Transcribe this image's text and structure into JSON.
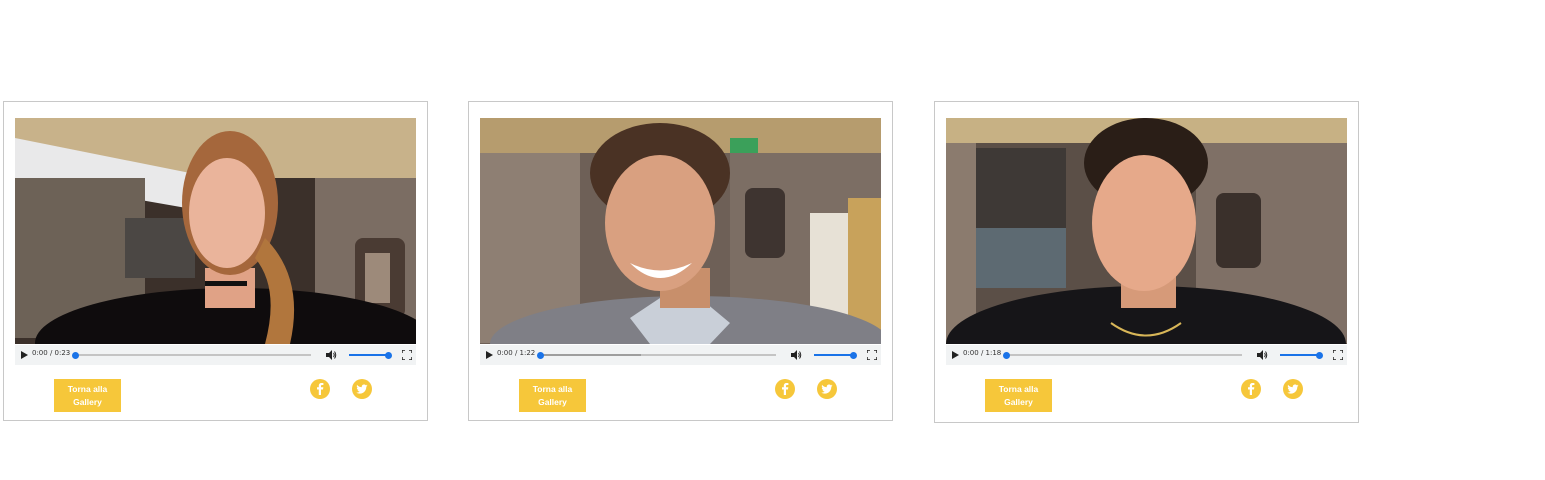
{
  "cards": [
    {
      "time": "0:00 / 0:23",
      "progress": 0,
      "buffered": 0,
      "volume": 1,
      "gallery_label": "Torna alla Gallery",
      "facebook_icon": "facebook-icon",
      "twitter_icon": "twitter-icon"
    },
    {
      "time": "0:00 / 1:22",
      "progress": 0,
      "buffered": 0.43,
      "volume": 1,
      "gallery_label": "Torna alla Gallery",
      "facebook_icon": "facebook-icon",
      "twitter_icon": "twitter-icon"
    },
    {
      "time": "0:00 / 1:18",
      "progress": 0,
      "buffered": 0,
      "volume": 1,
      "gallery_label": "Torna alla Gallery",
      "facebook_icon": "facebook-icon",
      "twitter_icon": "twitter-icon"
    }
  ],
  "colors": {
    "accent": "#f6c73a",
    "player_bar": "#f1f3f4",
    "player_blue": "#1a73e8"
  }
}
